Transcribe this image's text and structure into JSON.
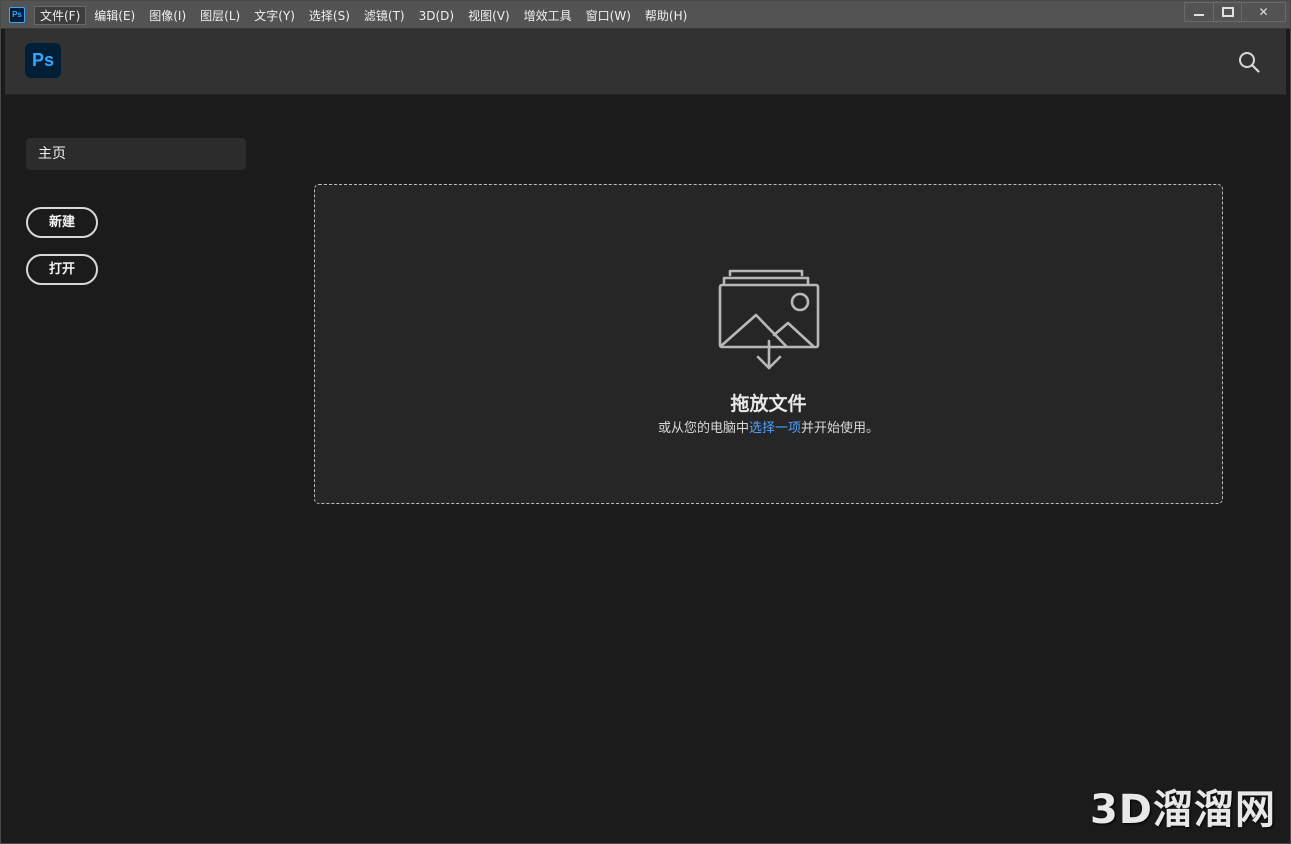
{
  "app": {
    "mini_icon_label": "Ps",
    "logo_label": "Ps"
  },
  "menubar": {
    "items": [
      "文件(F)",
      "编辑(E)",
      "图像(I)",
      "图层(L)",
      "文字(Y)",
      "选择(S)",
      "滤镜(T)",
      "3D(D)",
      "视图(V)",
      "增效工具",
      "窗口(W)",
      "帮助(H)"
    ],
    "active_index": 0
  },
  "window_controls": {
    "minimize": "minimize-icon",
    "maximize": "maximize-icon",
    "close": "✕"
  },
  "header": {
    "search_icon": "search-icon"
  },
  "sidebar": {
    "home_label": "主页",
    "new_label": "新建",
    "open_label": "打开"
  },
  "drop_zone": {
    "icon": "image-stack-download-icon",
    "title": "拖放文件",
    "subtitle_before": "或从您的电脑中",
    "subtitle_link": "选择一项",
    "subtitle_after": "并开始使用。"
  },
  "watermark": {
    "text": "3D溜溜网"
  },
  "colors": {
    "accent_blue": "#31a8ff",
    "link_blue": "#4ea1ff",
    "background": "#1b1b1b",
    "header": "#323232",
    "menubar": "#535353"
  }
}
